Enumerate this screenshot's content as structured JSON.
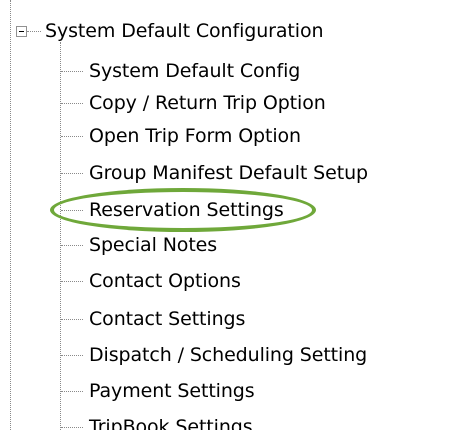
{
  "tree": {
    "root": {
      "label": "System Default Configuration",
      "expanded": true,
      "children": [
        {
          "label": "System Default Config"
        },
        {
          "label": "Copy / Return Trip Option"
        },
        {
          "label": "Open Trip Form Option"
        },
        {
          "label": "Group Manifest Default Setup"
        },
        {
          "label": "Reservation Settings",
          "highlighted": true
        },
        {
          "label": "Special Notes"
        },
        {
          "label": "Contact Options"
        },
        {
          "label": "Contact Settings"
        },
        {
          "label": "Dispatch / Scheduling Setting"
        },
        {
          "label": "Payment Settings"
        },
        {
          "label": "TripBook Settings"
        }
      ]
    }
  },
  "colors": {
    "highlight_ring": "#6fa83a",
    "tree_lines": "#8a8a8a"
  }
}
